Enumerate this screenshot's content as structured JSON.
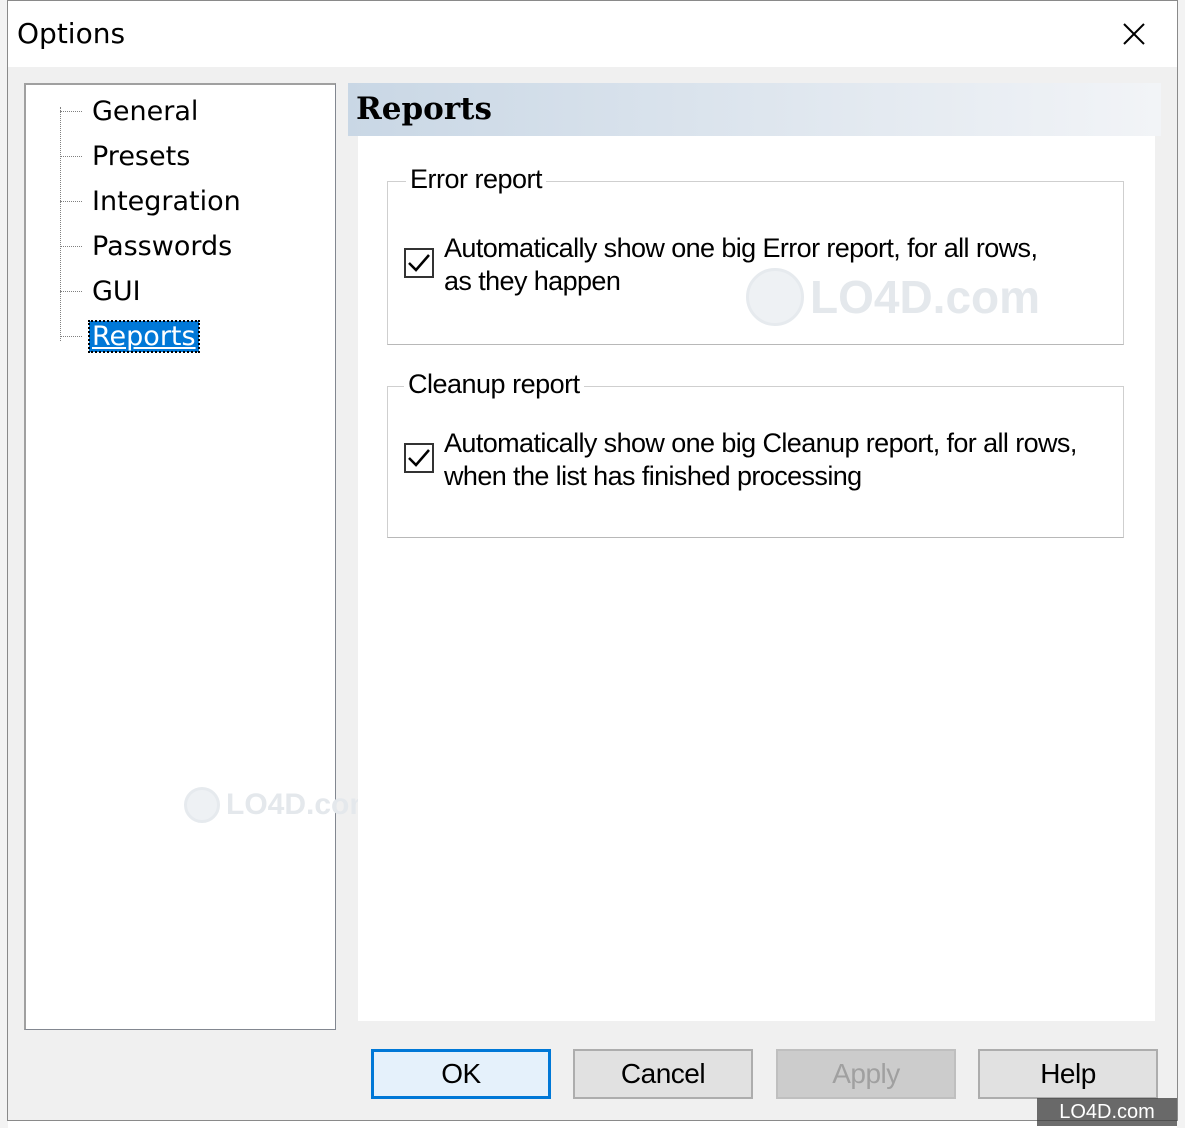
{
  "window": {
    "title": "Options"
  },
  "tree": {
    "items": [
      {
        "label": "General",
        "selected": false
      },
      {
        "label": "Presets",
        "selected": false
      },
      {
        "label": "Integration",
        "selected": false
      },
      {
        "label": "Passwords",
        "selected": false
      },
      {
        "label": "GUI",
        "selected": false
      },
      {
        "label": "Reports",
        "selected": true
      }
    ]
  },
  "content": {
    "title": "Reports",
    "error_report": {
      "legend": "Error report",
      "checkbox": {
        "checked": true,
        "line1": "Automatically show one big Error report, for all rows,",
        "line2": "as they happen"
      }
    },
    "cleanup_report": {
      "legend": "Cleanup report",
      "checkbox": {
        "checked": true,
        "line1": "Automatically show one big Cleanup report, for all rows,",
        "line2": "when the list has finished processing"
      }
    }
  },
  "buttons": {
    "ok": "OK",
    "cancel": "Cancel",
    "apply": "Apply",
    "help": "Help"
  },
  "watermark": {
    "text": "LO4D.com"
  },
  "colors": {
    "accent": "#0078d7",
    "header_gradient_start": "#c9d7e5"
  }
}
